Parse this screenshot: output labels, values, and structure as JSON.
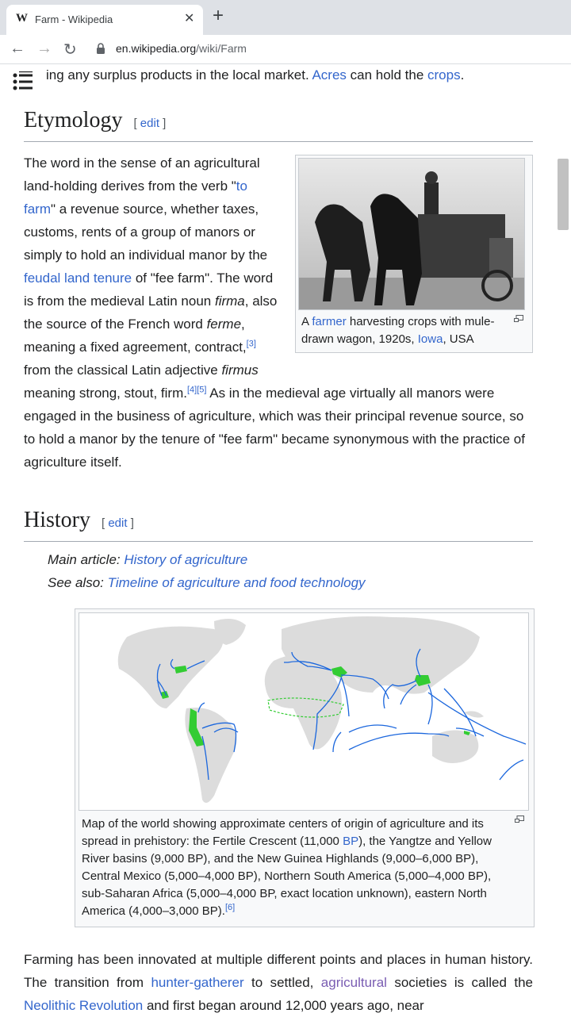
{
  "browser": {
    "tab_title": "Farm - Wikipedia",
    "tab_favicon": "W",
    "url_host": "en.wikipedia.org",
    "url_path": "/wiki/Farm"
  },
  "lead": {
    "pre": "ing any surplus products in the local market. ",
    "link1": "Acres",
    "mid": " can hold the ",
    "link2": "crops",
    "post": "."
  },
  "etymology": {
    "title": "Etymology",
    "edit": "edit",
    "t1": "The word in the sense of an agricultural land-holding derives from the verb \"",
    "link_to_farm": "to farm",
    "t2": "\" a revenue source, whether taxes, customs, rents of a group of manors or simply to hold an individual manor by the ",
    "link_feudal": "feudal land tenure",
    "t3": " of \"fee farm\". The word is from the medieval Latin noun ",
    "firma": "firma",
    "t4": ", also the source of the French word ",
    "ferme": "ferme",
    "t5": ", meaning a fixed agreement, contract,",
    "ref3": "[3]",
    "t6": " from the classical Latin adjective ",
    "firmus": "firmus",
    "t7": " meaning strong, stout, firm.",
    "ref4": "[4]",
    "ref5": "[5]",
    "t8": " As in the medieval age virtually all manors were engaged in the business of agriculture, which was their principal revenue source, so to hold a manor by the tenure of \"fee farm\" became synonymous with the practice of agriculture itself.",
    "caption_pre": "A ",
    "caption_link1": "farmer",
    "caption_mid": " harvesting crops with mule-drawn wagon, 1920s, ",
    "caption_link2": "Iowa",
    "caption_post": ", USA"
  },
  "history": {
    "title": "History",
    "edit": "edit",
    "main_label": "Main article: ",
    "main_link": "History of agriculture",
    "see_label": "See also: ",
    "see_link": "Timeline of agriculture and food technology",
    "map_caption_1": "Map of the world showing approximate centers of origin of agriculture and its spread in prehistory: the Fertile Crescent (11,000 ",
    "map_caption_bp": "BP",
    "map_caption_2": "), the Yangtze and Yellow River basins (9,000 BP), and the New Guinea Highlands (9,000–6,000 BP), Central Mexico (5,000–4,000 BP), Northern South America (5,000–4,000 BP), sub-Saharan Africa (5,000–4,000 BP, exact location unknown), eastern North America (4,000–3,000 BP).",
    "ref6": "[6]",
    "p1": "Farming has been innovated at multiple different points and places in human history. The transition from ",
    "link_hg": "hunter-gatherer",
    "p2": " to settled, ",
    "link_agri": "agricultural",
    "p3": " societies is called the ",
    "link_neo": "Neolithic Revolution",
    "p4": " and first began around 12,000 years ago, near"
  },
  "colors": {
    "link": "#3366cc",
    "visited_link": "#795cb2",
    "origin_green": "#33cc33",
    "spread_arrow": "#1a66dd"
  },
  "icons": [
    "wikipedia-favicon",
    "close-icon",
    "plus-icon",
    "back-arrow-icon",
    "forward-arrow-icon",
    "reload-icon",
    "lock-icon",
    "toc-list-icon",
    "magnify-icon"
  ]
}
